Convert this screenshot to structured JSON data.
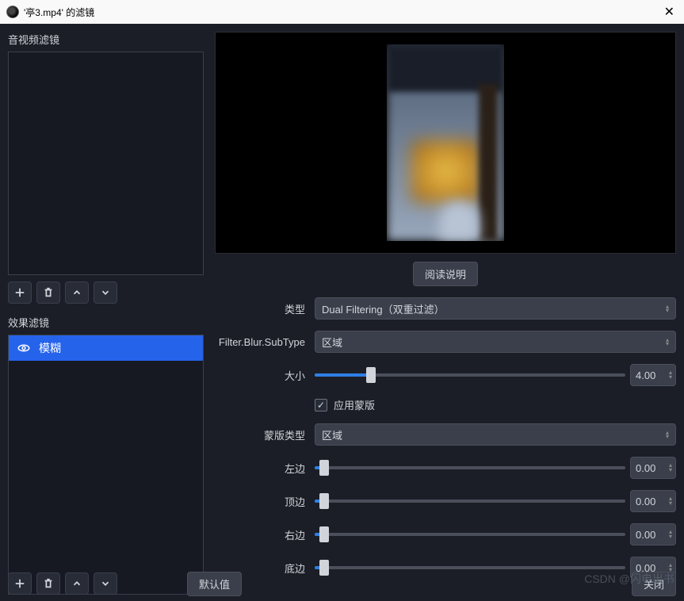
{
  "titlebar": {
    "title": "'亭3.mp4' 的滤镜"
  },
  "left": {
    "av_label": "音视频滤镜",
    "effect_label": "效果滤镜",
    "effect_items": [
      {
        "name": "模糊"
      }
    ]
  },
  "right": {
    "read_instructions": "阅读说明",
    "rows": {
      "type": {
        "label": "类型",
        "value": "Dual Filtering（双重过滤）"
      },
      "subtype": {
        "label": "Filter.Blur.SubType",
        "value": "区域"
      },
      "size": {
        "label": "大小",
        "value": "4.00",
        "percent": 18
      },
      "mask_check": {
        "label": "应用蒙版",
        "checked": true
      },
      "mask_type": {
        "label": "蒙版类型",
        "value": "区域"
      },
      "left_edge": {
        "label": "左边",
        "value": "0.00",
        "percent": 3
      },
      "top_edge": {
        "label": "顶边",
        "value": "0.00",
        "percent": 3
      },
      "right_edge": {
        "label": "右边",
        "value": "0.00",
        "percent": 3
      },
      "bottom_edge": {
        "label": "底边",
        "value": "0.00",
        "percent": 3
      }
    }
  },
  "bottom": {
    "defaults": "默认值",
    "close": "关闭"
  },
  "watermark": "CSDN @闪电出书"
}
